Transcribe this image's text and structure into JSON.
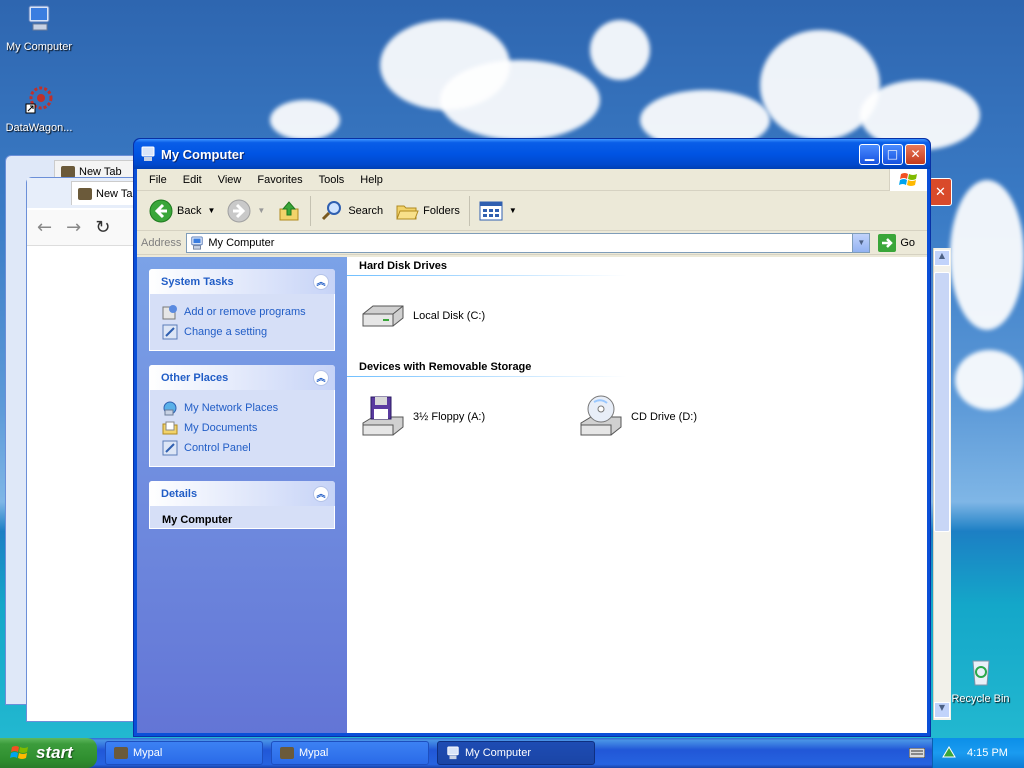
{
  "desktop": {
    "icons": [
      {
        "label": "My Computer"
      },
      {
        "label": "DataWagon..."
      },
      {
        "label": "Recycle Bin"
      }
    ]
  },
  "background_windows": {
    "tab1": "New Tab",
    "tab2": "New Ta"
  },
  "window": {
    "title": "My Computer",
    "menu": [
      "File",
      "Edit",
      "View",
      "Favorites",
      "Tools",
      "Help"
    ],
    "toolbar": {
      "back": "Back",
      "search": "Search",
      "folders": "Folders"
    },
    "address": {
      "label": "Address",
      "value": "My Computer",
      "go": "Go"
    },
    "left_pane": {
      "system_tasks": {
        "title": "System Tasks",
        "links": [
          "Add or remove programs",
          "Change a setting"
        ]
      },
      "other_places": {
        "title": "Other Places",
        "links": [
          "My Network Places",
          "My Documents",
          "Control Panel"
        ]
      },
      "details": {
        "title": "Details",
        "name": "My Computer"
      }
    },
    "content": {
      "hard_disk_drives": {
        "heading": "Hard Disk Drives",
        "items": [
          "Local Disk (C:)"
        ]
      },
      "removable_storage": {
        "heading": "Devices with Removable Storage",
        "items": [
          "3½ Floppy (A:)",
          "CD Drive (D:)"
        ]
      }
    }
  },
  "taskbar": {
    "start": "start",
    "tasks": [
      "Mypal",
      "Mypal",
      "My Computer"
    ],
    "clock": "4:15 PM"
  },
  "colors": {
    "title_bar": "#0054e3",
    "task_pane_link": "#215dc6",
    "start_button": "#3c9c3c"
  }
}
